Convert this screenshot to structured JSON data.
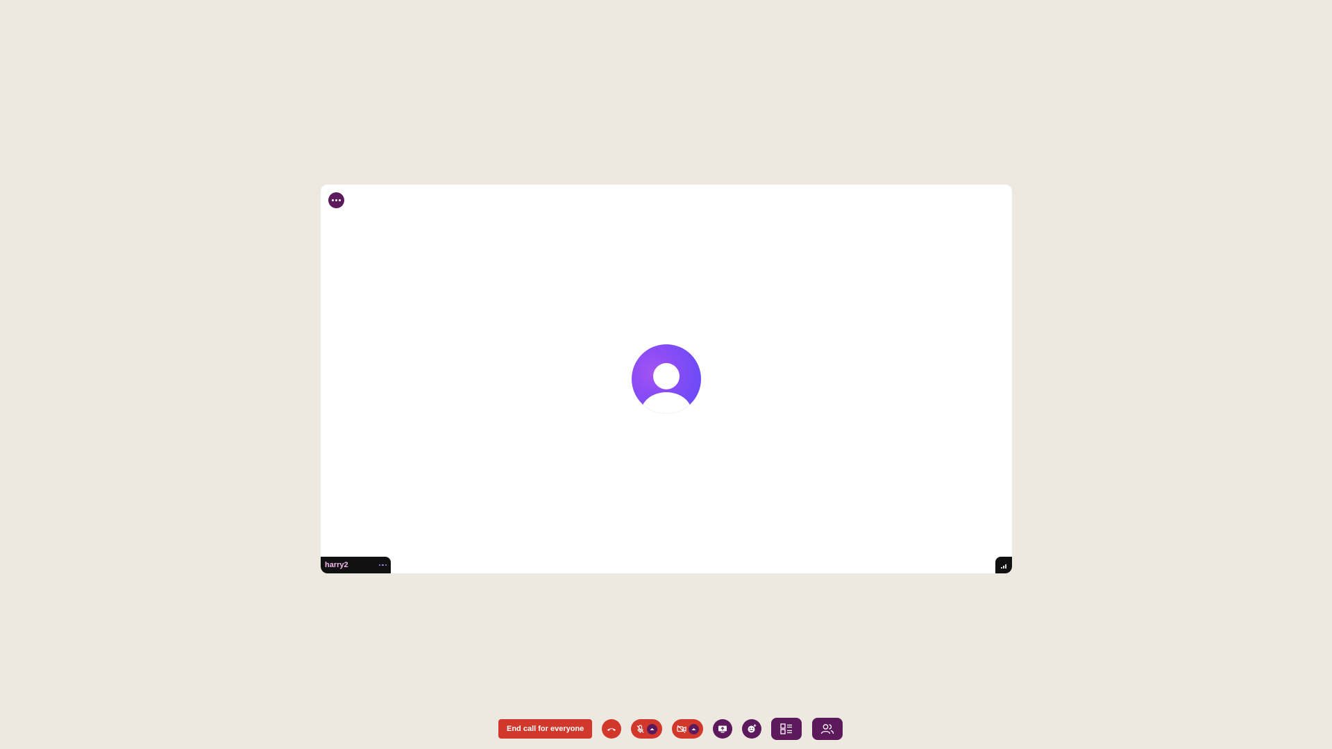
{
  "tile": {
    "participant_name": "harry2"
  },
  "toolbar": {
    "end_call_everyone_label": "End call for everyone"
  },
  "colors": {
    "background": "#ede9e1",
    "danger": "#d2372c",
    "brand": "#5c1a5c",
    "avatar": "#7a4cf5"
  },
  "icons": {
    "tile_menu": "more-horizontal-icon",
    "avatar": "user-avatar-icon",
    "name_menu": "more-horizontal-icon",
    "signal": "signal-bars-icon",
    "hangup": "phone-hangup-icon",
    "mic": "mic-off-icon",
    "camera": "camera-off-icon",
    "share": "screen-share-icon",
    "reactions": "emoji-reaction-icon",
    "layout": "layout-icon",
    "participants": "people-icon"
  }
}
